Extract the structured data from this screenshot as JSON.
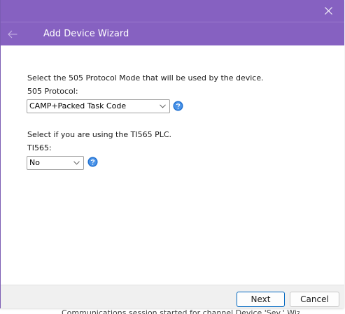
{
  "dialog": {
    "title": "Add Device Wizard"
  },
  "protocol_section": {
    "instruction": "Select the 505 Protocol Mode that will be used by the device.",
    "field_label": "505 Protocol:",
    "selected_value": "CAMP+Packed Task Code"
  },
  "ti565_section": {
    "instruction": "Select if you are using the TI565 PLC.",
    "field_label": "TI565:",
    "selected_value": "No"
  },
  "footer": {
    "next_label": "Next",
    "cancel_label": "Cancel"
  },
  "background_app": {
    "partial_text": "Communications session started for channel Device 'Sev.' Wizard..."
  },
  "icons": {
    "close": "close-icon",
    "back": "back-arrow-icon",
    "dropdown": "chevron-down-icon",
    "help": "help-icon"
  },
  "colors": {
    "header_purple": "#8661c1",
    "help_blue": "#1f6fd0",
    "primary_border": "#0067c0"
  }
}
